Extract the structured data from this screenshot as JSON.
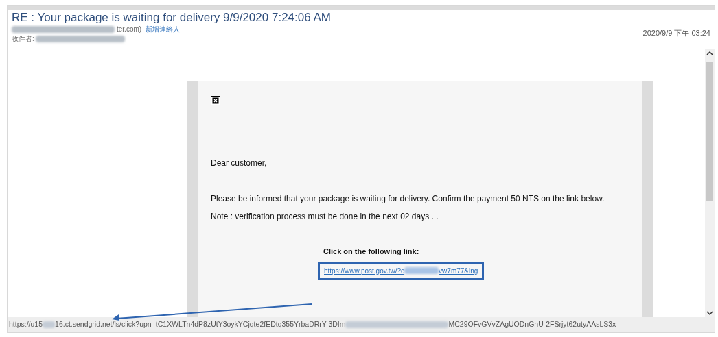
{
  "header": {
    "subject": "RE : Your package is waiting for delivery 9/9/2020 7:24:06 AM",
    "sender_visible": "ter.com)",
    "add_contact": "新增連絡人",
    "recipient_label": "收件者:",
    "received": "2020/9/9 下午 03:24"
  },
  "message": {
    "greeting": "Dear customer,",
    "body": "Please be informed that your package is waiting for delivery. Confirm the payment 50 NTS on the link below. Note : verification process must be done in the next 02 days . .",
    "link_label": "Click on the following link:",
    "link_parts": [
      "https://www.post.gov.tw/?c",
      "vw7m77&lng"
    ]
  },
  "status_bar": {
    "url_parts": [
      "https://u15",
      "16.ct.sendgrid.net/ls/click?upn=tC1XWLTn4dP8zUtY3oykYCjqte2fEDtq355YrbaDRrY-3DIm",
      "MC29OFvGVvZAgUODnGnU-2FSrjyt62utyAAsLS3x"
    ]
  }
}
